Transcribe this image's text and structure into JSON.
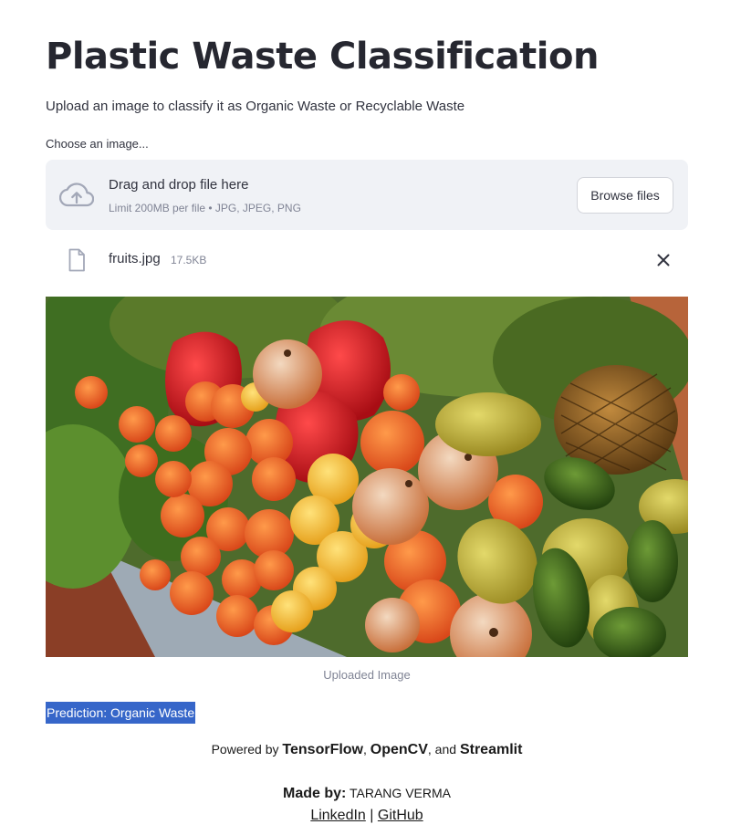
{
  "page": {
    "title": "Plastic Waste Classification",
    "subtitle": "Upload an image to classify it as Organic Waste or Recyclable Waste"
  },
  "uploader": {
    "label": "Choose an image...",
    "drag_text": "Drag and drop file here",
    "limit_text": "Limit 200MB per file • JPG, JPEG, PNG",
    "browse_label": "Browse files",
    "icon": "cloud-upload-icon"
  },
  "file": {
    "name": "fruits.jpg",
    "size": "17.5KB",
    "icon": "file-icon",
    "remove_icon": "close-icon"
  },
  "image": {
    "caption": "Uploaded Image"
  },
  "result": {
    "prediction": "Prediction: Organic Waste"
  },
  "footer": {
    "powered_prefix": "Powered by",
    "tech1": "TensorFlow",
    "sep1": ",",
    "tech2": "OpenCV",
    "sep2": ", and",
    "tech3": "Streamlit",
    "made_by_label": "Made by:",
    "author": "TARANG VERMA",
    "link1": "LinkedIn",
    "link_sep": "|",
    "link2": "GitHub"
  },
  "colors": {
    "highlight": "#3666c9",
    "dropzone_bg": "#f0f2f6",
    "muted_text": "#808495",
    "title_text": "#262730"
  }
}
